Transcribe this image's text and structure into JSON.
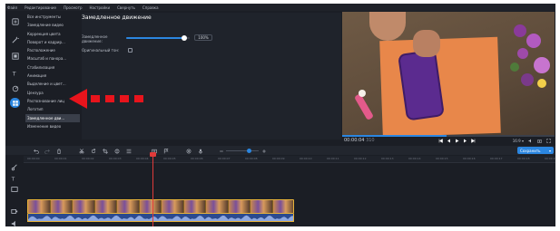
{
  "menu": [
    "Файл",
    "Редактирование",
    "Просмотр",
    "Настройки",
    "Свернуть",
    "Справка"
  ],
  "effects": [
    "Все инструменты",
    "Замедление видео",
    "Коррекция цвета",
    "Поворот и кадрир...",
    "Расположение",
    "Масштаб и панора...",
    "Стабилизация",
    "Анимация",
    "Выделение и цвет...",
    "Цензура",
    "Распознавание лиц",
    "Логотип",
    "Замедленное дви...",
    "Изменение видео"
  ],
  "selected_effect_index": 12,
  "settings": {
    "title": "Замедленное движение",
    "slowdown_label": "Замедленное движение:",
    "slowdown_value_text": "100%",
    "slowdown_fraction": 0.92,
    "original_sound_label": "Оригинальный тон:"
  },
  "playback": {
    "time": "00:00:04",
    "time_ms": "310",
    "progress_fraction": 0.49,
    "aspect": "16:9 ▾"
  },
  "toolbar": {
    "save_label": "Сохранить",
    "zoom_fraction": 0.7
  },
  "ruler_ticks": [
    "00:00:00",
    "00:00:01",
    "00:00:02",
    "00:00:03",
    "00:00:04",
    "00:00:05",
    "00:00:06",
    "00:00:07",
    "00:00:08",
    "00:00:09",
    "00:00:10",
    "00:00:11",
    "00:00:12",
    "00:00:13",
    "00:00:14",
    "00:00:15",
    "00:00:16",
    "00:00:17",
    "00:00:18",
    "00:00:19"
  ],
  "timeline": {
    "video_thumb_count": 12
  },
  "colors": {
    "accent": "#2b86e0",
    "playhead": "#e03a3a",
    "clip_border": "#e7b23a",
    "arrow": "#e8141c"
  },
  "icons": {
    "tools": [
      "import-icon",
      "magic-wand-icon",
      "filters-icon",
      "titles-icon",
      "stickers-icon",
      "more-tools-icon"
    ]
  }
}
